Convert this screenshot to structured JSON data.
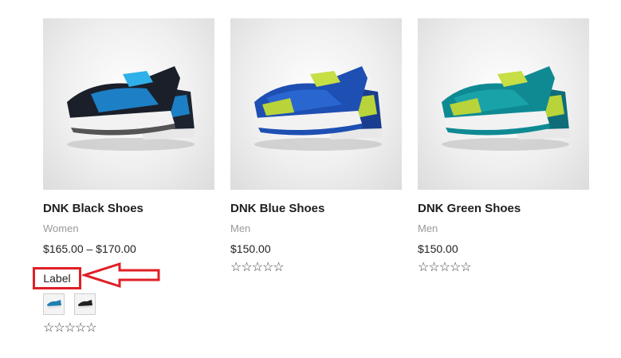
{
  "products": [
    {
      "title": "DNK Black Shoes",
      "category": "Women",
      "price": "$165.00 – $170.00",
      "rating": "☆☆☆☆☆",
      "image": "black-blue-sneaker"
    },
    {
      "title": "DNK Blue Shoes",
      "category": "Men",
      "price": "$150.00",
      "rating": "☆☆☆☆☆",
      "image": "blue-lime-sneaker"
    },
    {
      "title": "DNK Green Shoes",
      "category": "Men",
      "price": "$150.00",
      "rating": "☆☆☆☆☆",
      "image": "teal-lime-sneaker"
    }
  ],
  "annotation": {
    "label": "Label",
    "color": "#e01f26"
  },
  "variation_swatches": [
    "teal-sneaker-thumb",
    "black-sneaker-thumb"
  ],
  "colors": {
    "title": "#1f1f1f",
    "category": "#9a9a9a",
    "price": "#222222"
  }
}
